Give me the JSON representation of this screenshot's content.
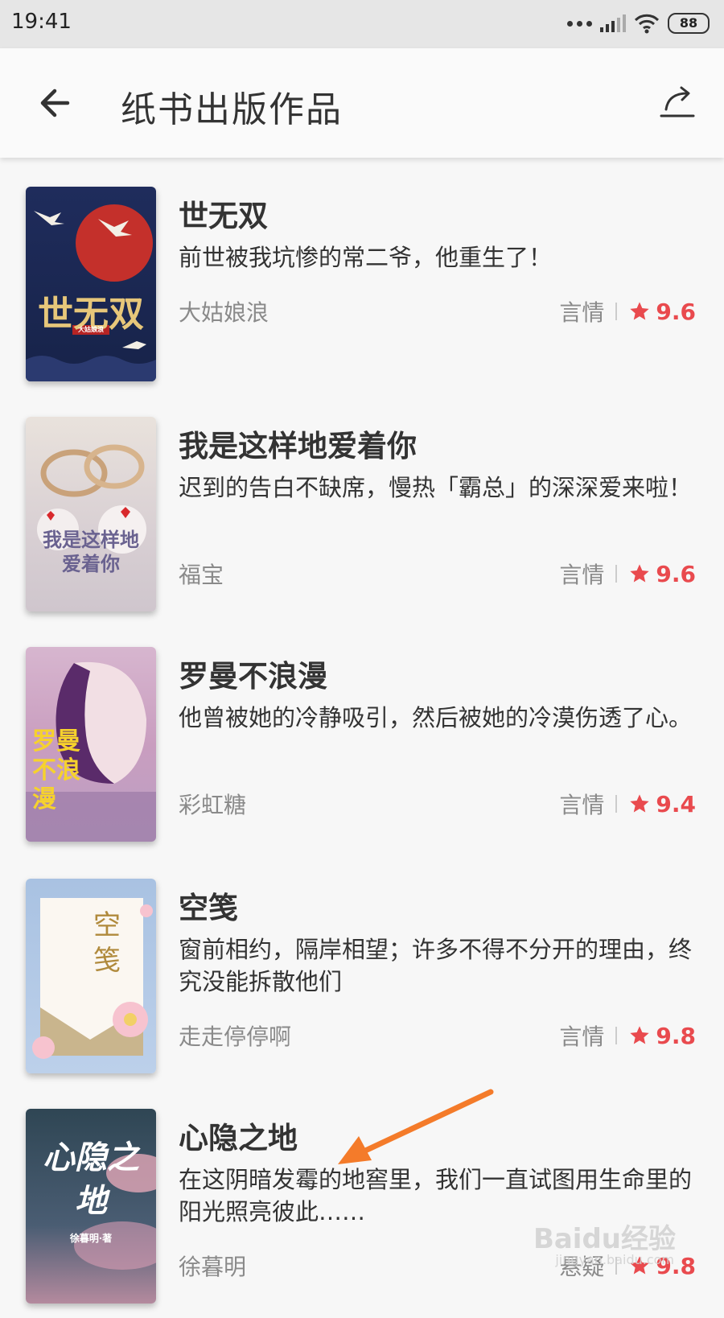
{
  "status_bar": {
    "time": "19:41",
    "battery": "88"
  },
  "header": {
    "title": "纸书出版作品",
    "back_icon": "back-arrow-icon",
    "share_icon": "share-icon"
  },
  "books": [
    {
      "title": "世无双",
      "desc": "前世被我坑惨的常二爷，他重生了！",
      "author": "大姑娘浪",
      "genre": "言情",
      "rating": "9.6",
      "cover_text": "世无双",
      "cover_sub": "大姑娘浪"
    },
    {
      "title": "我是这样地爱着你",
      "desc": "迟到的告白不缺席，慢热「霸总」的深深爱来啦！",
      "author": "福宝",
      "genre": "言情",
      "rating": "9.6",
      "cover_text": "我是这样地爱着你"
    },
    {
      "title": "罗曼不浪漫",
      "desc": "他曾被她的冷静吸引，然后被她的冷漠伤透了心。",
      "author": "彩虹糖",
      "genre": "言情",
      "rating": "9.4",
      "cover_text": "罗曼不浪漫"
    },
    {
      "title": "空笺",
      "desc": "窗前相约，隔岸相望；许多不得不分开的理由，终究没能拆散他们",
      "author": "走走停停啊",
      "genre": "言情",
      "rating": "9.8",
      "cover_text": "空笺"
    },
    {
      "title": "心隐之地",
      "desc": "在这阴暗发霉的地窖里，我们一直试图用生命里的阳光照亮彼此……",
      "author": "徐暮明",
      "genre": "悬疑",
      "rating": "9.8",
      "cover_text": "心隐之地",
      "cover_sub": "徐暮明·著"
    }
  ],
  "watermark": {
    "brand": "Baidu经验",
    "url": "jingyan.baidu.com"
  },
  "colors": {
    "rating": "#e94a4e",
    "annotation_arrow": "#f47b2a"
  }
}
